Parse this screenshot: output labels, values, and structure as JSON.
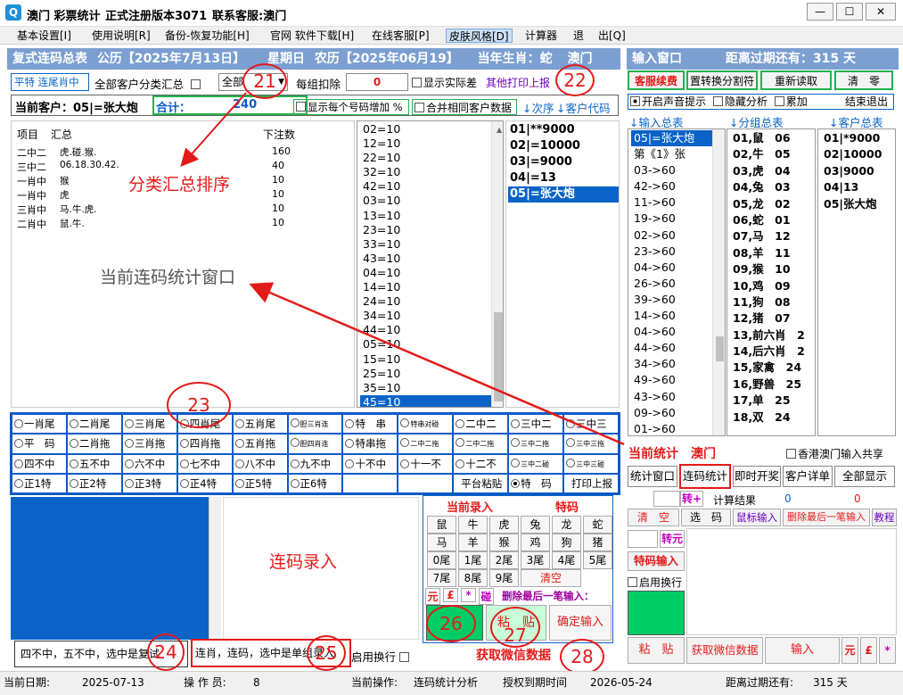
{
  "window": {
    "title": "澳门 彩票统计",
    "version": "正式注册版本3071",
    "contact": "联系客服:澳门",
    "controls": [
      "—",
      "☐",
      "✕"
    ]
  },
  "menu": [
    "基本设置[I]",
    "使用说明[R]",
    "备份-恢复功能[H]",
    "官网 软件下载[H]",
    "在线客服[P]",
    "皮肤风格[D]",
    "计算器",
    "退",
    "出[Q]"
  ],
  "header": {
    "title": "复式连码总表",
    "solar": "公历【2025年7月13日】",
    "weekday": "星期日",
    "lunar": "农历【2025年06月19】",
    "zodiac": "当年生肖：蛇",
    "region": "澳门"
  },
  "filter": {
    "mode": "平特 连尾肖中",
    "all_customers": "全部客户分类汇总",
    "select_value": "全部",
    "deduct_label": "每组扣除",
    "deduct_value": "0",
    "show_actual": "显示实际差",
    "print_label": "其他打印上报"
  },
  "customer": {
    "label": "当前客户：05|=张大炮",
    "total_label": "合计：",
    "total_value": "240",
    "show_increase": "显示每个号码增加",
    "percent": "%",
    "merge_label": "合并相同客户数据",
    "order": "↓次序",
    "code": "↓客户代码"
  },
  "summary": {
    "headers": [
      "项目",
      "汇总",
      "下注数"
    ],
    "rows": [
      [
        "二中二",
        "虎.碰.猴.",
        "160"
      ],
      [
        "三中二",
        "06.18.30.42.",
        "40"
      ],
      [
        "一肖中",
        "猴",
        "10"
      ],
      [
        "一肖中",
        "虎",
        "10"
      ],
      [
        "三肖中",
        "马.牛.虎.",
        "10"
      ],
      [
        "二肖中",
        "鼠.牛.",
        "10"
      ]
    ]
  },
  "numbers": [
    "02=10",
    "12=10",
    "22=10",
    "32=10",
    "42=10",
    "03=10",
    "13=10",
    "23=10",
    "33=10",
    "43=10",
    "04=10",
    "14=10",
    "24=10",
    "34=10",
    "44=10",
    "05=10",
    "15=10",
    "25=10",
    "35=10",
    "45=10"
  ],
  "customers_list": [
    "01|**9000",
    "02|=10000",
    "03|=9000",
    "04|=13",
    "05|=张大炮"
  ],
  "grid_rows": [
    [
      "一肖尾",
      "二肖尾",
      "三肖尾",
      "四肖尾",
      "五肖尾",
      "胆三肖连",
      "特　串",
      "特串对碰",
      "二中二",
      "三中二",
      "三中三"
    ],
    [
      "平　码",
      "二肖拖",
      "三肖拖",
      "四肖拖",
      "五肖拖",
      "胆四肖连",
      "特串拖",
      "二中二拖",
      "二中二拖",
      "三中二拖",
      "三中三拖"
    ],
    [
      "四不中",
      "五不中",
      "六不中",
      "七不中",
      "八不中",
      "九不中",
      "十不中",
      "十一不",
      "十二不",
      "三中二碰",
      "三中三碰"
    ],
    [
      "正1特",
      "正2特",
      "正3特",
      "正4特",
      "正5特",
      "正6特",
      "",
      "",
      "平台粘贴",
      "特　码",
      "打印上报"
    ]
  ],
  "entry": {
    "title_left": "当前录入",
    "title_right": "特码",
    "zodiac_row1": [
      "鼠",
      "牛",
      "虎",
      "兔",
      "龙",
      "蛇"
    ],
    "zodiac_row2": [
      "马",
      "羊",
      "猴",
      "鸡",
      "狗",
      "猪"
    ],
    "tail_row1": [
      "0尾",
      "1尾",
      "2尾",
      "3尾",
      "4尾",
      "5尾"
    ],
    "tail_row2": [
      "7尾",
      "8尾",
      "9尾",
      "清空"
    ],
    "symbols": [
      "元",
      "£",
      "*",
      "碰"
    ],
    "delete_last": "删除最后一笔输入：",
    "paste": "粘　贴",
    "confirm": "确定输入",
    "wechat": "获取微信数据",
    "hint1": "四不中，五不中，选中是复试",
    "hint2": "连肖，连码，选中是单组录入",
    "wrap": "启用换行"
  },
  "annotations": {
    "sort": "分类汇总排序",
    "window": "当前连码统计窗口",
    "entry": "连码录入",
    "marks": [
      "21",
      "22",
      "23",
      "24",
      "25",
      "26",
      "27",
      "28"
    ]
  },
  "right": {
    "title": "输入窗口",
    "expire": "距离过期还有：315 天",
    "buttons": [
      "客服续费",
      "置转换分割符",
      "重新读取",
      "清　零"
    ],
    "sound": "开启声音提示",
    "hide": "隐藏分析",
    "accumulate": "累加",
    "exit": "结束退出",
    "col_headers": [
      "↓输入总表",
      "↓分组总表",
      "↓客户总表"
    ],
    "input_list": [
      "05|=张大炮",
      "第《1》张",
      "03->60",
      "42->60",
      "11->60",
      "19->60",
      "02->60",
      "23->60",
      "04->60",
      "26->60",
      "39->60",
      "14->60",
      "04->60",
      "44->60",
      "34->60",
      "49->60",
      "43->60",
      "09->60",
      "01->60"
    ],
    "group_list": [
      "01,鼠　06",
      "02,牛　05",
      "03,虎　04",
      "04,兔　03",
      "05,龙　02",
      "06,蛇　01",
      "07,马　12",
      "08,羊　11",
      "09,猴　10",
      "10,鸡　09",
      "11,狗　08",
      "12,猪　07",
      "13,前六肖　2",
      "14,后六肖　2",
      "15,家禽　24",
      "16,野兽　25",
      "17,单　25",
      "18,双　24"
    ],
    "customer_list": [
      "01|*9000",
      "02|10000",
      "03|9000",
      "04|13",
      "05|张大炮"
    ],
    "stat_title": "当前统计　澳门",
    "hk_share": "香港澳门输入共享",
    "tabs": [
      "统计窗口",
      "连码统计",
      "即时开奖",
      "客户详单",
      "全部显示"
    ],
    "convert": "转+",
    "calc_label": "计算结果",
    "calc_value1": "0",
    "calc_value2": "0",
    "row_btns": [
      "清　空",
      "选　码",
      "鼠标输入",
      "删除最后一笔输入",
      "教程"
    ],
    "yuan": "转元",
    "tema_input": "特码输入",
    "wrap": "启用换行",
    "paste": "粘　贴",
    "wechat": "获取微信数据",
    "input": "输入",
    "symbols": [
      "元",
      "£",
      "*"
    ]
  },
  "status": {
    "date_label": "当前日期:",
    "date": "2025-07-13",
    "operator_label": "操 作 员:",
    "operator": "8",
    "op_label": "当前操作:",
    "op": "连码统计分析",
    "auth_label": "授权到期时间",
    "auth": "2026-05-24",
    "expire_label": "距离过期还有:",
    "expire": "315 天"
  },
  "colors": {
    "accent_blue": "#0a64c8",
    "title_bar": "#7b9fd0",
    "red": "#e41a1a",
    "green": "#00cc66"
  }
}
